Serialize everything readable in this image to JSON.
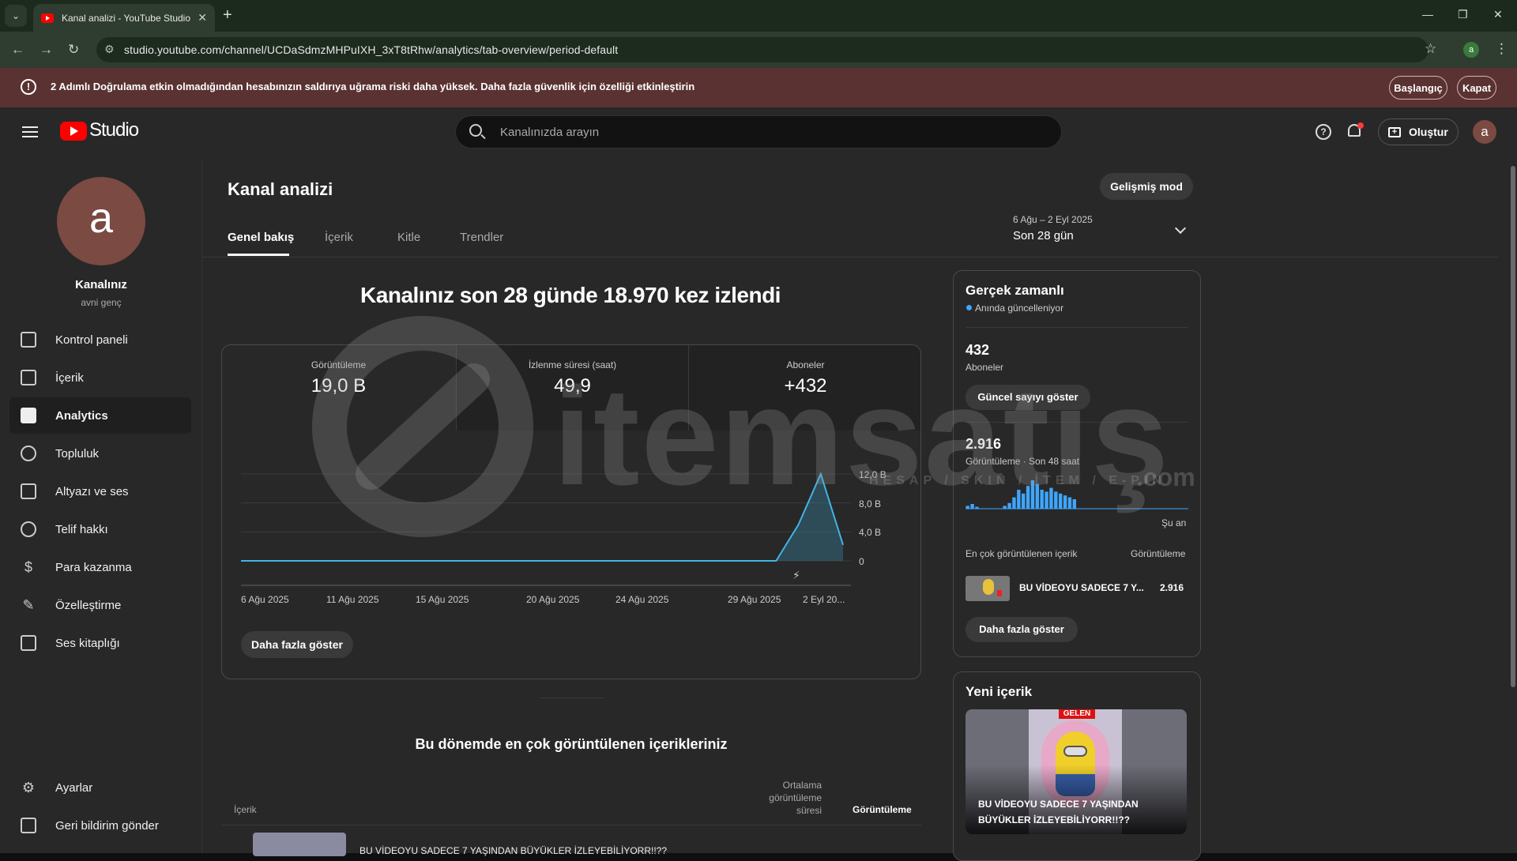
{
  "browser": {
    "tab_title": "Kanal analizi - YouTube Studio",
    "url": "studio.youtube.com/channel/UCDaSdmzMHPuIXH_3xT8tRhw/analytics/tab-overview/period-default",
    "profile_initial": "a"
  },
  "banner": {
    "text": "2 Adımlı Doğrulama etkin olmadığından hesabınızın saldırıya uğrama riski daha yüksek. Daha fazla güvenlik için özelliği etkinleştirin",
    "start_label": "Başlangıç",
    "close_label": "Kapat",
    "color": "#5a3232"
  },
  "header": {
    "logo_text": "Studio",
    "search_placeholder": "Kanalınızda arayın",
    "create_label": "Oluştur",
    "avatar_initial": "a"
  },
  "sidebar": {
    "avatar_initial": "a",
    "channel_title": "Kanalınız",
    "channel_name": "avni genç",
    "items": [
      {
        "label": "Kontrol paneli",
        "icon": "dashboard-icon"
      },
      {
        "label": "İçerik",
        "icon": "content-icon"
      },
      {
        "label": "Analytics",
        "icon": "analytics-icon",
        "active": true
      },
      {
        "label": "Topluluk",
        "icon": "community-icon"
      },
      {
        "label": "Altyazı ve ses",
        "icon": "subtitles-icon"
      },
      {
        "label": "Telif hakkı",
        "icon": "copyright-icon"
      },
      {
        "label": "Para kazanma",
        "icon": "monetization-icon"
      },
      {
        "label": "Özelleştirme",
        "icon": "customization-icon"
      },
      {
        "label": "Ses kitaplığı",
        "icon": "audio-library-icon"
      }
    ],
    "bottom_items": [
      {
        "label": "Ayarlar",
        "icon": "gear-icon"
      },
      {
        "label": "Geri bildirim gönder",
        "icon": "feedback-icon"
      }
    ]
  },
  "main": {
    "title": "Kanal analizi",
    "advanced_mode_label": "Gelişmiş mod",
    "tabs": [
      "Genel bakış",
      "İçerik",
      "Kitle",
      "Trendler"
    ],
    "date_range": "6 Ağu – 2 Eyl 2025",
    "date_label": "Son 28 gün",
    "headline": "Kanalınız son 28 günde 18.970 kez izlendi",
    "stats": [
      {
        "label": "Görüntüleme",
        "value": "19,0 B"
      },
      {
        "label": "İzlenme süresi (saat)",
        "value": "49,9"
      },
      {
        "label": "Aboneler",
        "value": "+432"
      }
    ],
    "show_more_label": "Daha fazla göster",
    "top_content_title": "Bu dönemde en çok görüntülenen içerikleriniz",
    "table_headers": {
      "content": "İçerik",
      "avg_view_duration": [
        "Ortalama",
        "görüntüleme",
        "süresi"
      ],
      "views": "Görüntüleme"
    },
    "first_row_title": "BU VİDEOYU SADECE 7 YAŞINDAN BÜYÜKLER İZLEYEBİLİYORR!!??"
  },
  "chart_data": {
    "type": "area",
    "x": [
      "6 Ağu 2025",
      "7 Ağu 2025",
      "8 Ağu 2025",
      "9 Ağu 2025",
      "10 Ağu 2025",
      "11 Ağu 2025",
      "12 Ağu 2025",
      "13 Ağu 2025",
      "14 Ağu 2025",
      "15 Ağu 2025",
      "16 Ağu 2025",
      "17 Ağu 2025",
      "18 Ağu 2025",
      "19 Ağu 2025",
      "20 Ağu 2025",
      "21 Ağu 2025",
      "22 Ağu 2025",
      "23 Ağu 2025",
      "24 Ağu 2025",
      "25 Ağu 2025",
      "26 Ağu 2025",
      "27 Ağu 2025",
      "28 Ağu 2025",
      "29 Ağu 2025",
      "30 Ağu 2025",
      "31 Ağu 2025",
      "1 Eyl 2025",
      "2 Eyl 2025"
    ],
    "values": [
      0,
      0,
      0,
      0,
      0,
      0,
      0,
      0,
      0,
      0,
      0,
      0,
      0,
      0,
      0,
      0,
      0,
      0,
      0,
      0,
      0,
      0,
      0,
      0,
      0,
      5000,
      12000,
      2200
    ],
    "tick_labels_x": [
      "6 Ağu 2025",
      "11 Ağu 2025",
      "15 Ağu 2025",
      "20 Ağu 2025",
      "24 Ağu 2025",
      "29 Ağu 2025",
      "2 Eyl 20..."
    ],
    "tick_labels_y": [
      "12,0 B",
      "8,0 B",
      "4,0 B",
      "0"
    ],
    "ylim": [
      0,
      12000
    ],
    "color": "#41b4e6",
    "grid": true
  },
  "realtime": {
    "title": "Gerçek zamanlı",
    "live_text": "Anında güncelleniyor",
    "subscribers_value": "432",
    "subscribers_label": "Aboneler",
    "show_count_label": "Güncel sayıyı göster",
    "views_value": "2.916",
    "views_label": "Görüntüleme · Son 48 saat",
    "now_label": "Şu an",
    "top_content_label": "En çok görüntülenen içerik",
    "top_views_label": "Görüntüleme",
    "top_item_title": "BU VİDEOYU SADECE 7 Y...",
    "top_item_views": "2.916",
    "show_more_label": "Daha fazla göster",
    "hourly_bars": [
      3,
      5,
      2,
      0,
      0,
      0,
      0,
      0,
      3,
      6,
      12,
      20,
      16,
      24,
      30,
      26,
      20,
      18,
      22,
      18,
      16,
      14,
      12,
      10,
      0,
      0,
      0,
      0,
      0,
      0,
      0,
      0,
      0,
      0,
      0,
      0,
      0,
      0,
      0,
      0,
      0,
      0,
      0,
      0,
      0,
      0,
      0,
      0
    ]
  },
  "new_content": {
    "title": "Yeni içerik",
    "badge": "GELEN",
    "caption": "BU VİDEOYU SADECE 7 YAŞINDAN BÜYÜKLER İZLEYEBİLİYORR!!??"
  },
  "watermark": {
    "text": "itemsatış",
    "sub": "HESAP / SKIN / İTEM / E-PIN",
    "com": ".com"
  }
}
